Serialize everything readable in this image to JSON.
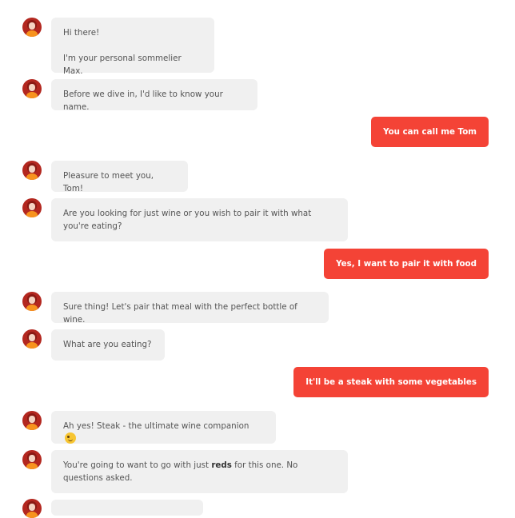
{
  "bot_name": "Max",
  "accent_color": "#f44336",
  "messages": [
    {
      "from": "bot",
      "lines": [
        "Hi there!",
        "I'm your personal sommelier Max."
      ]
    },
    {
      "from": "bot",
      "text": "Before we dive in, I'd like to know your name."
    },
    {
      "from": "user",
      "text": "You can call me Tom"
    },
    {
      "from": "bot",
      "text": "Pleasure to meet you, Tom!"
    },
    {
      "from": "bot",
      "text": "Are you looking for just wine or you wish to pair it with what you're eating?"
    },
    {
      "from": "user",
      "text": "Yes, I want to pair it with food"
    },
    {
      "from": "bot",
      "text": "Sure thing! Let's pair that meal with the perfect bottle of wine."
    },
    {
      "from": "bot",
      "text": "What are you eating?"
    },
    {
      "from": "user",
      "text": "It'll be a steak with some vegetables"
    },
    {
      "from": "bot",
      "text": "Ah yes! Steak - the ultimate wine companion",
      "emoji": "winking-face-icon"
    },
    {
      "from": "bot",
      "text_before": "You're going to want to go with just ",
      "bold": "reds",
      "text_after": " for this one. No questions asked."
    }
  ]
}
